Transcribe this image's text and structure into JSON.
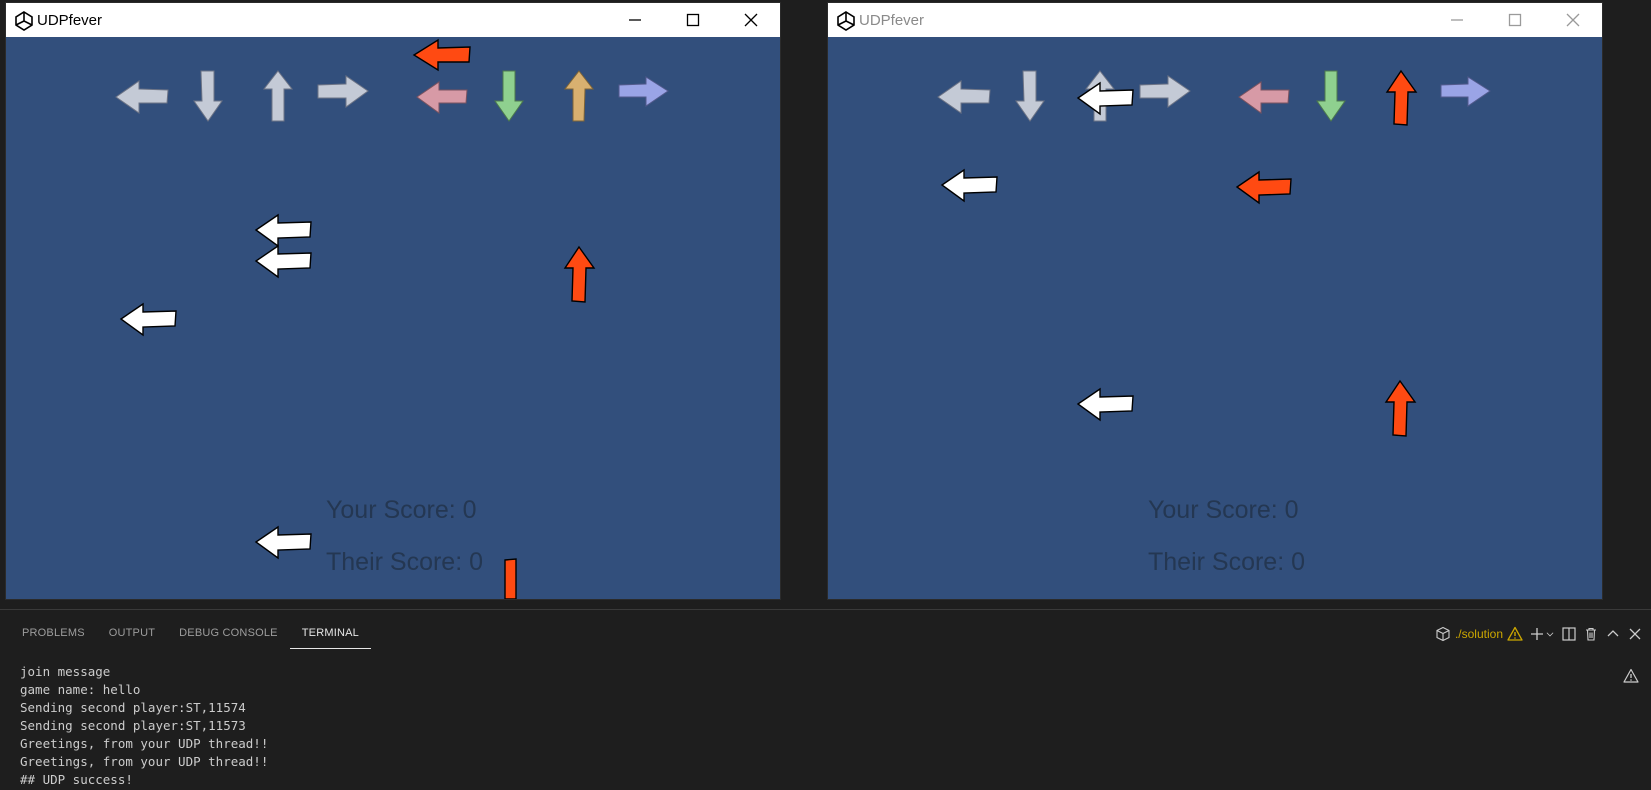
{
  "windows": [
    {
      "title": "UDPfever",
      "active": true,
      "score_yours": "Your Score: 0",
      "score_theirs": "Their Score: 0"
    },
    {
      "title": "UDPfever",
      "active": false,
      "score_yours": "Your Score: 0",
      "score_theirs": "Their Score: 0"
    }
  ],
  "game_colors": {
    "background": "#324f7c",
    "receptor_gray": "#c4cad6",
    "receptor_pink": "#d79aa6",
    "receptor_green": "#8fd08f",
    "receptor_gold": "#d8b070",
    "receptor_lavender": "#9aa4e6",
    "note_white": "#ffffff",
    "note_red": "#ff4a12",
    "score_text": "#243752"
  },
  "panel": {
    "tabs": [
      "PROBLEMS",
      "OUTPUT",
      "DEBUG CONSOLE",
      "TERMINAL"
    ],
    "active_tab": "TERMINAL",
    "terminal_name": "./solution",
    "terminal_lines": [
      "join message",
      "game name: hello",
      "Sending second player:ST,11574",
      "Sending second player:ST,11573",
      "Greetings, from your UDP thread!!",
      "Greetings, from your UDP thread!!",
      "## UDP success!"
    ]
  }
}
